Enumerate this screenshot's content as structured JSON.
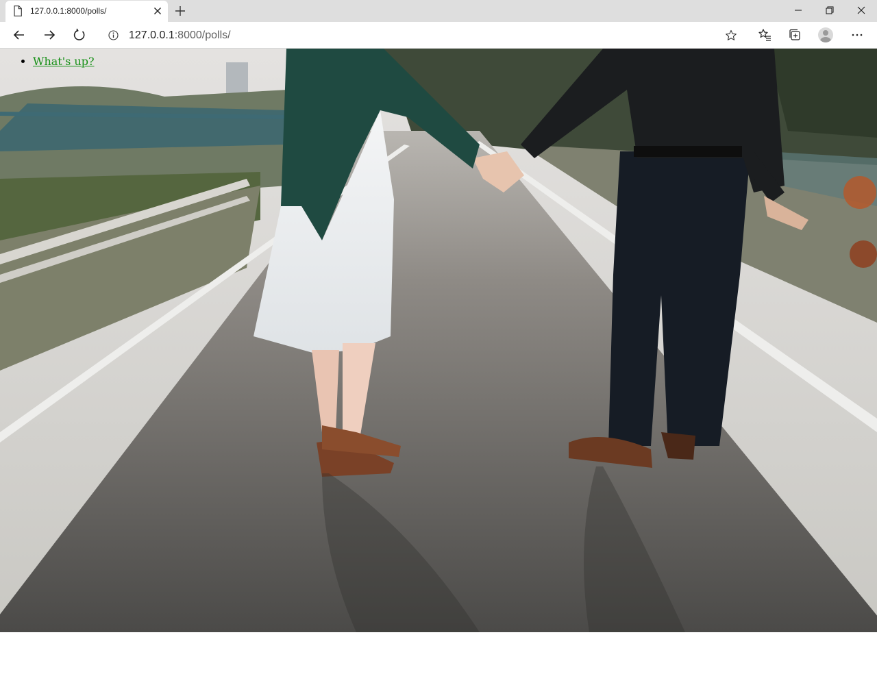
{
  "browser": {
    "tab_title": "127.0.0.1:8000/polls/",
    "url_host": "127.0.0.1",
    "url_rest": ":8000/polls/"
  },
  "icons": {
    "tab_favicon": "page-icon",
    "tab_close": "close-icon",
    "new_tab": "plus-icon",
    "minimize": "minimize-icon",
    "restore": "restore-icon",
    "window_close": "close-icon",
    "back": "arrow-left-icon",
    "forward": "arrow-right-icon",
    "reload": "reload-icon",
    "site_info": "info-icon",
    "favorite": "star-icon",
    "favorites": "favorites-icon",
    "collections": "collections-icon",
    "profile": "avatar",
    "more": "more-icon"
  },
  "page": {
    "polls": [
      {
        "question": "What's up?"
      }
    ]
  },
  "colors": {
    "link": "#148f14",
    "tabstrip": "#dedede"
  }
}
